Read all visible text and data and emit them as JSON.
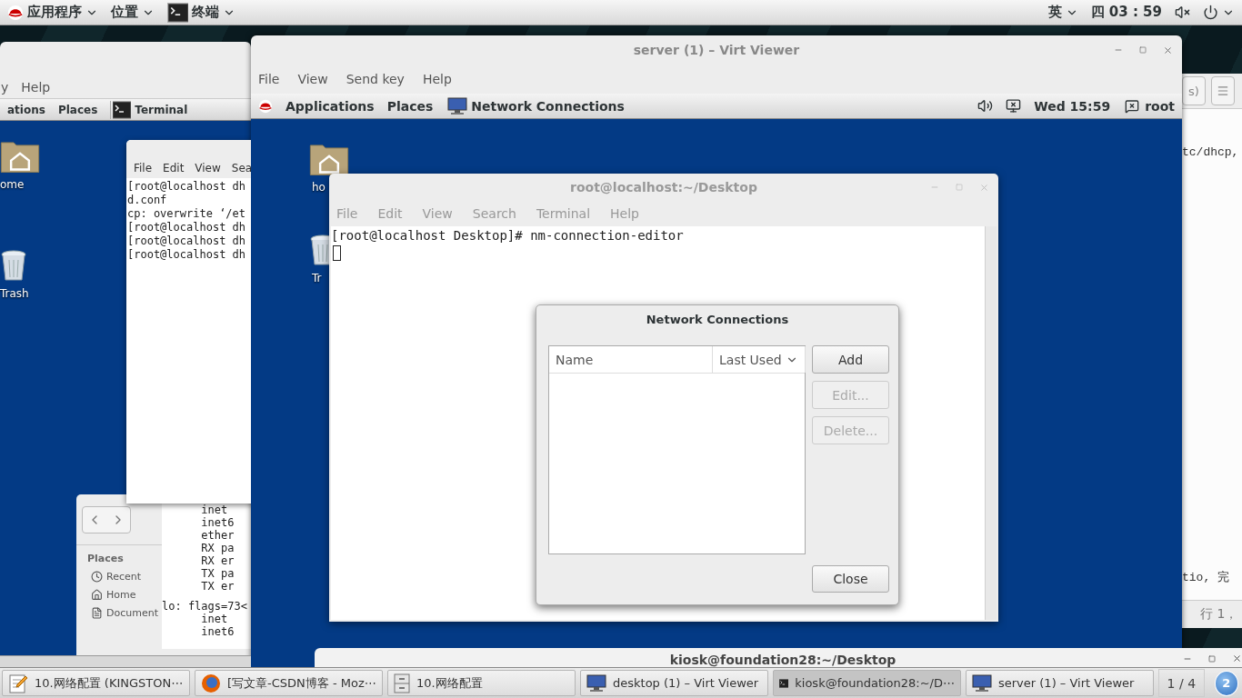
{
  "top_bar": {
    "applications": "应用程序",
    "places": "位置",
    "app": "终端",
    "input_method": "英",
    "clock": "四 03 : 59"
  },
  "desktop_viewer": {
    "menu": [
      "y",
      "Help"
    ],
    "guest_panel": {
      "items": [
        "ations",
        "Places"
      ],
      "app": "Terminal"
    },
    "desktop_icons": [
      {
        "kind": "home",
        "label": "ome"
      },
      {
        "kind": "trash",
        "label": "Trash"
      }
    ],
    "terminal": {
      "menu": [
        "File",
        "Edit",
        "View",
        "Sea"
      ],
      "lines": [
        "[root@localhost dh",
        "d.conf",
        "cp: overwrite ‘/et",
        "[root@localhost dh",
        "[root@localhost dh",
        "[root@localhost dh"
      ]
    },
    "file_manager": {
      "heading": "Places",
      "items": [
        {
          "kind": "recent",
          "label": "Recent"
        },
        {
          "kind": "home",
          "label": "Home"
        },
        {
          "kind": "document",
          "label": "Document"
        }
      ]
    },
    "background_terminal": {
      "blocks": [
        [
          "      inet",
          "      inet6",
          "      ether",
          "      RX pa",
          "      RX er",
          "      TX pa",
          "      TX er"
        ],
        [
          "lo: flags=73<",
          "      inet",
          "      inet6"
        ]
      ]
    }
  },
  "server_viewer": {
    "title": "server (1) – Virt Viewer",
    "menu": [
      "File",
      "View",
      "Send key",
      "Help"
    ],
    "guest_panel": {
      "items": [
        "Applications",
        "Places"
      ],
      "app": "Network Connections",
      "clock": "Wed 15:59",
      "user": "root"
    },
    "desktop_icons": [
      {
        "kind": "home",
        "label": "ho"
      },
      {
        "kind": "trash",
        "label": "Tr"
      }
    ],
    "terminal": {
      "title": "root@localhost:~/Desktop",
      "active": false,
      "menu": [
        "File",
        "Edit",
        "View",
        "Search",
        "Terminal",
        "Help"
      ],
      "lines": [
        "[root@localhost Desktop]# nm-connection-editor"
      ]
    },
    "dialog": {
      "title": "Network Connections",
      "columns": [
        {
          "label": "Name",
          "sorted": false
        },
        {
          "label": "Last Used",
          "sorted": true
        }
      ],
      "buttons": [
        {
          "label": "Add",
          "disabled": false
        },
        {
          "label": "Edit...",
          "disabled": true
        },
        {
          "label": "Delete...",
          "disabled": true
        }
      ],
      "close": "Close"
    }
  },
  "text_editor": {
    "header_button": "s)",
    "lines": [
      "tc/dhcp,",
      "tio, 完"
    ],
    "status": "行 1，"
  },
  "kiosk_terminal": {
    "title": "kiosk@foundation28:~/Desktop"
  },
  "taskbar": {
    "items": [
      {
        "kind": "editor",
        "label": "10.网络配置 (KINGSTON⋯",
        "selected": false
      },
      {
        "kind": "browser",
        "label": "[写文章-CSDN博客 - Moz⋯",
        "selected": false
      },
      {
        "kind": "cabinet",
        "label": "10.网络配置",
        "selected": false
      },
      {
        "kind": "viewer",
        "label": "desktop (1) – Virt Viewer",
        "selected": false
      },
      {
        "kind": "terminal",
        "label": "kiosk@foundation28:~/D⋯",
        "selected": true
      },
      {
        "kind": "viewer",
        "label": "server (1) – Virt Viewer",
        "selected": false
      }
    ],
    "workspace": "1 / 4",
    "badge": "2"
  }
}
